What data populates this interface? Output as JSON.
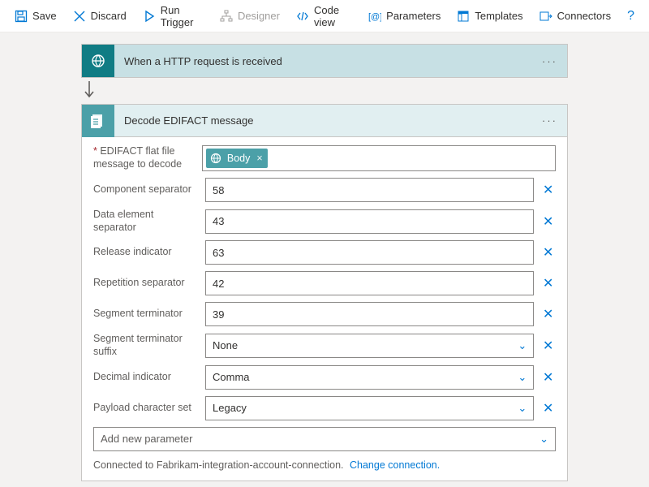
{
  "toolbar": {
    "save": "Save",
    "discard": "Discard",
    "run": "Run Trigger",
    "designer": "Designer",
    "codeview": "Code view",
    "parameters": "Parameters",
    "templates": "Templates",
    "connectors": "Connectors"
  },
  "trigger": {
    "title": "When a HTTP request is received"
  },
  "action": {
    "title": "Decode EDIFACT message",
    "fields": {
      "flatfile_label": "EDIFACT flat file message to decode",
      "flatfile_token": "Body",
      "component_sep_label": "Component separator",
      "component_sep_value": "58",
      "data_elem_label": "Data element separator",
      "data_elem_value": "43",
      "release_label": "Release indicator",
      "release_value": "63",
      "repetition_label": "Repetition separator",
      "repetition_value": "42",
      "segment_term_label": "Segment terminator",
      "segment_term_value": "39",
      "segment_suffix_label": "Segment terminator suffix",
      "segment_suffix_value": "None",
      "decimal_label": "Decimal indicator",
      "decimal_value": "Comma",
      "payload_label": "Payload character set",
      "payload_value": "Legacy"
    },
    "add_param": "Add new parameter",
    "connection_text": "Connected to Fabrikam-integration-account-connection.",
    "change_connection": "Change connection."
  }
}
